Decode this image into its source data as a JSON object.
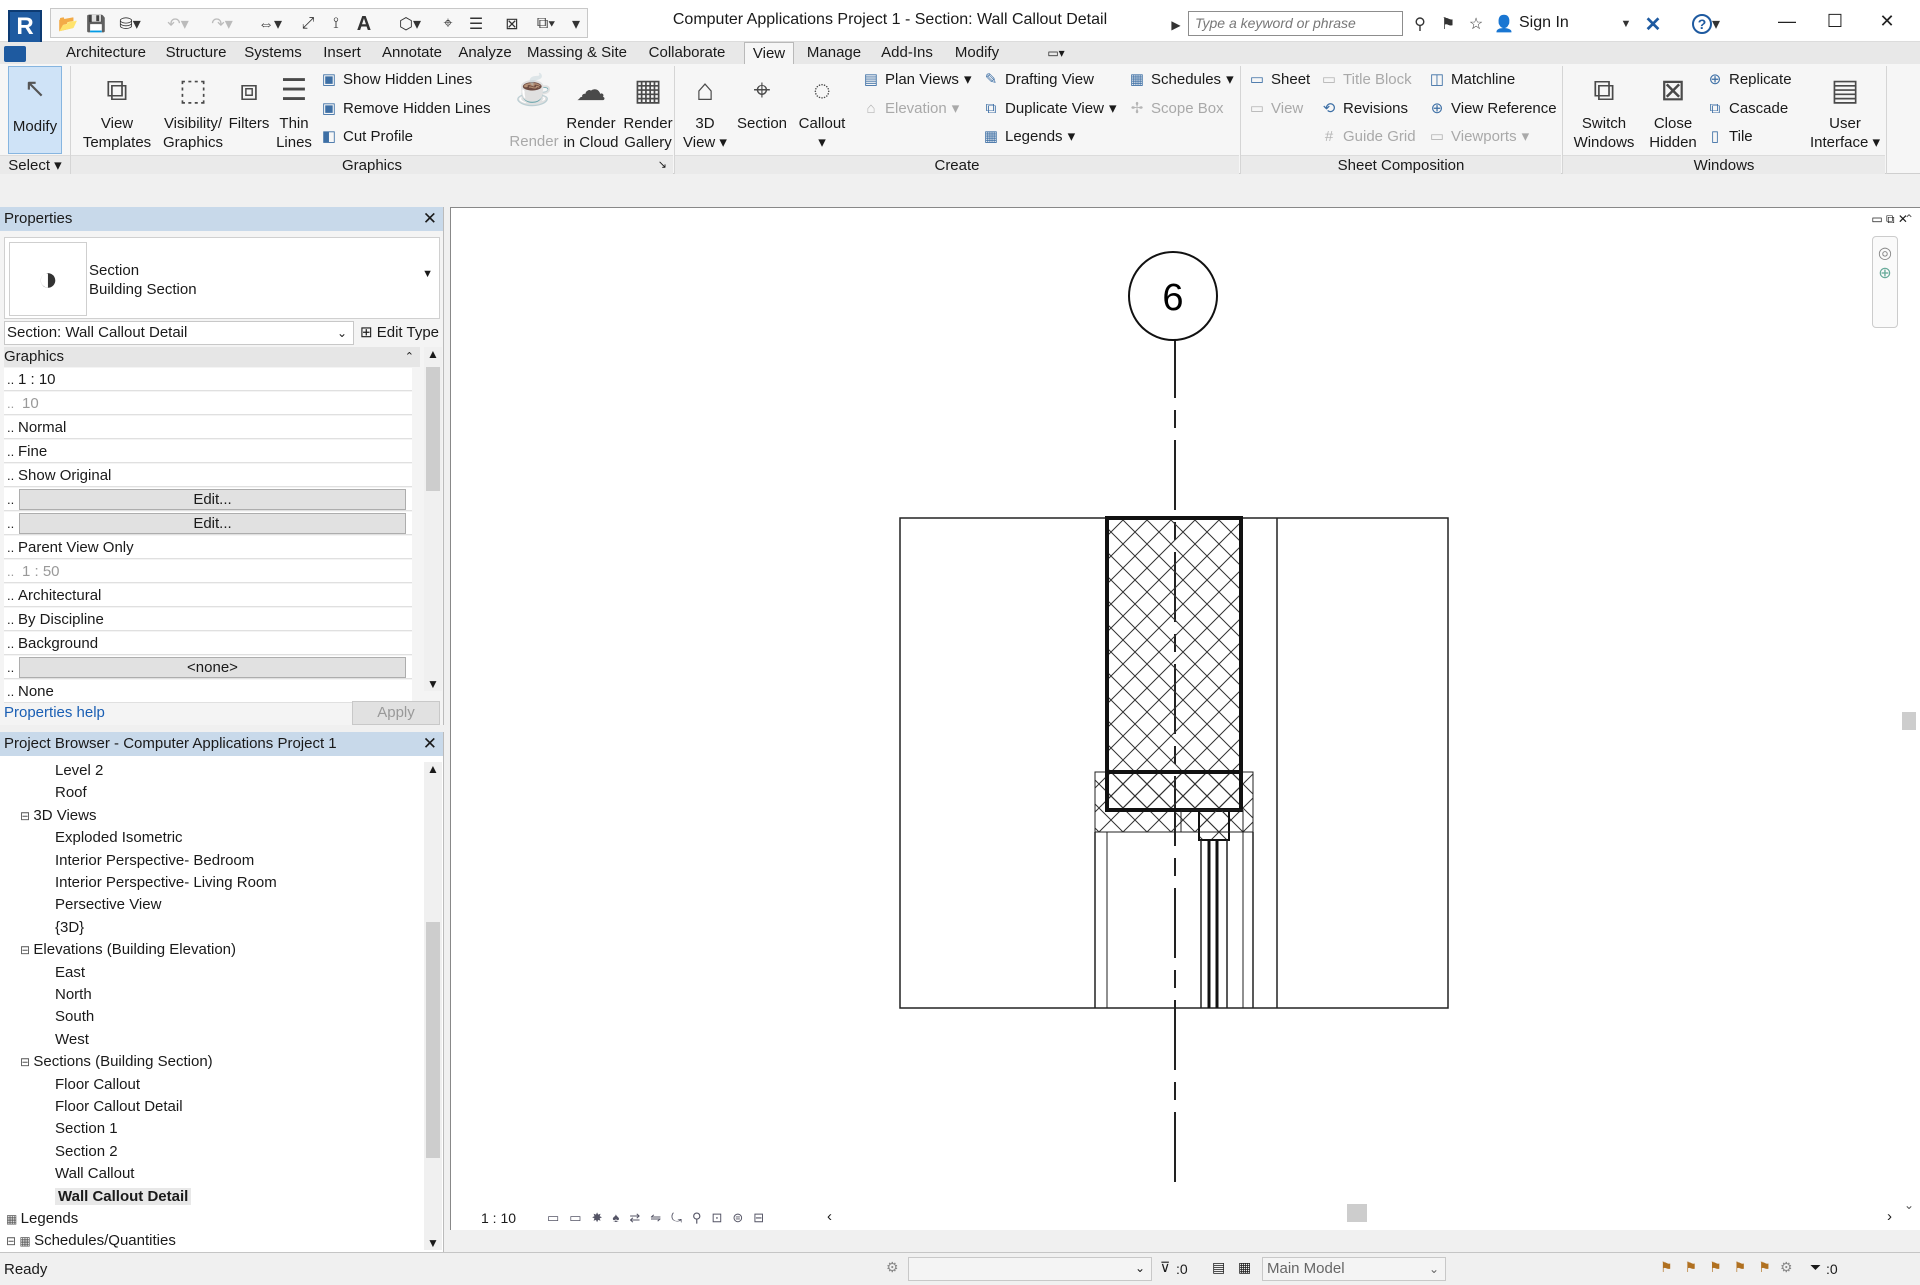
{
  "app": {
    "title": "Computer Applications Project 1 - Section: Wall Callout Detail",
    "search_placeholder": "Type a keyword or phrase",
    "sign_in": "Sign In",
    "logo": "R"
  },
  "tabs": [
    "Architecture",
    "Structure",
    "Systems",
    "Insert",
    "Annotate",
    "Analyze",
    "Massing & Site",
    "Collaborate",
    "View",
    "Manage",
    "Add-Ins",
    "Modify"
  ],
  "active_tab": "View",
  "ribbon": {
    "select": {
      "modify": "Modify",
      "select_label": "Select"
    },
    "graphics": {
      "label": "Graphics",
      "view_templates": [
        "View",
        "Templates"
      ],
      "visibility": [
        "Visibility/",
        "Graphics"
      ],
      "filters": "Filters",
      "thin_lines": [
        "Thin",
        "Lines"
      ],
      "show_hidden": "Show  Hidden Lines",
      "remove_hidden": "Remove  Hidden Lines",
      "cut_profile": "Cut  Profile"
    },
    "presentation": {
      "render": "Render",
      "render_cloud": [
        "Render",
        "in Cloud"
      ],
      "render_gallery": [
        "Render",
        "Gallery"
      ]
    },
    "create": {
      "label": "Create",
      "view3d": [
        "3D",
        "View"
      ],
      "section": "Section",
      "callout": "Callout",
      "plan_views": "Plan  Views",
      "elevation": "Elevation",
      "drafting_view": "Drafting  View",
      "duplicate_view": "Duplicate  View",
      "legends": "Legends",
      "schedules": "Schedules",
      "scope_box": "Scope  Box"
    },
    "sheet": {
      "label": "Sheet Composition",
      "sheet": "Sheet",
      "view": "View",
      "title_block": "Title  Block",
      "revisions": "Revisions",
      "guide_grid": "Guide  Grid",
      "matchline": "Matchline",
      "view_reference": "View  Reference",
      "viewports": "Viewports"
    },
    "windows": {
      "label": "Windows",
      "switch": [
        "Switch",
        "Windows"
      ],
      "close_hidden": [
        "Close",
        "Hidden"
      ],
      "replicate": "Replicate",
      "cascade": "Cascade",
      "tile": "Tile",
      "user_interface": [
        "User",
        "Interface"
      ]
    }
  },
  "properties": {
    "header": "Properties",
    "type_line1": "Section",
    "type_line2": "Building Section",
    "instance": "Section: Wall Callout Detail",
    "edit_type": "Edit Type",
    "group": "Graphics",
    "rows": [
      {
        "value": "1 : 10",
        "kind": "text"
      },
      {
        "value": "10",
        "kind": "grey"
      },
      {
        "value": "Normal",
        "kind": "text"
      },
      {
        "value": "Fine",
        "kind": "text"
      },
      {
        "value": "Show Original",
        "kind": "text"
      },
      {
        "value": "Edit...",
        "kind": "button"
      },
      {
        "value": "Edit...",
        "kind": "button"
      },
      {
        "value": "Parent View Only",
        "kind": "text"
      },
      {
        "value": "1 : 50",
        "kind": "grey"
      },
      {
        "value": "Architectural",
        "kind": "text"
      },
      {
        "value": "By Discipline",
        "kind": "text"
      },
      {
        "value": "Background",
        "kind": "text"
      },
      {
        "value": "<none>",
        "kind": "button"
      },
      {
        "value": "None",
        "kind": "text"
      }
    ],
    "help": "Properties help",
    "apply": "Apply"
  },
  "browser": {
    "header": "Project Browser - Computer Applications Project 1",
    "items": [
      {
        "label": "Level 2",
        "level": 2
      },
      {
        "label": "Roof",
        "level": 2
      },
      {
        "label": "3D Views",
        "level": 1,
        "toggle": "⊟"
      },
      {
        "label": "Exploded Isometric",
        "level": 2
      },
      {
        "label": "Interior Perspective- Bedroom",
        "level": 2
      },
      {
        "label": "Interior Perspective- Living Room",
        "level": 2
      },
      {
        "label": "Persective View",
        "level": 2
      },
      {
        "label": "{3D}",
        "level": 2
      },
      {
        "label": "Elevations (Building Elevation)",
        "level": 1,
        "toggle": "⊟"
      },
      {
        "label": "East",
        "level": 2
      },
      {
        "label": "North",
        "level": 2
      },
      {
        "label": "South",
        "level": 2
      },
      {
        "label": "West",
        "level": 2
      },
      {
        "label": "Sections (Building Section)",
        "level": 1,
        "toggle": "⊟"
      },
      {
        "label": "Floor Callout",
        "level": 2
      },
      {
        "label": "Floor Callout Detail",
        "level": 2
      },
      {
        "label": "Section 1",
        "level": 2
      },
      {
        "label": "Section 2",
        "level": 2
      },
      {
        "label": "Wall Callout",
        "level": 2
      },
      {
        "label": "Wall Callout Detail",
        "level": 2,
        "selected": true
      },
      {
        "label": "Legends",
        "level": 0,
        "toggle": "▦"
      },
      {
        "label": "Schedules/Quantities",
        "level": 0,
        "toggle": "⊟ ▦"
      }
    ]
  },
  "canvas": {
    "section_tag": "6",
    "scale": "1 : 10"
  },
  "status": {
    "ready": "Ready",
    "zero1": ":0",
    "model": "Main Model",
    "zero2": ":0"
  },
  "colors": {
    "accent": "#c8d9ea",
    "modify_bg": "#cfe3f7",
    "link": "#1a5fb4"
  }
}
